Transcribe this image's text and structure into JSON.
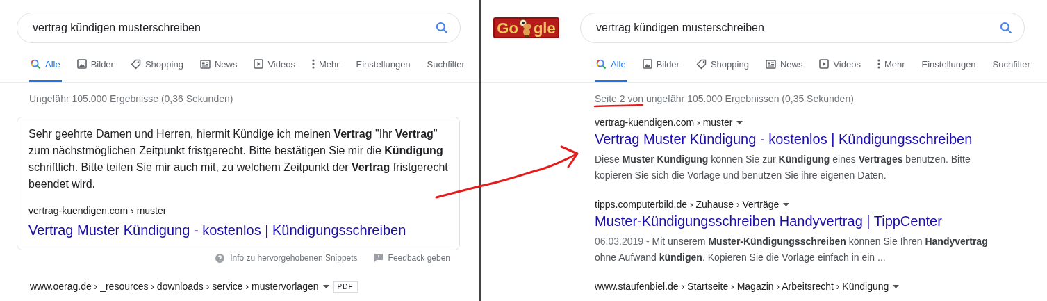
{
  "annotation": {
    "kind": "arrow-and-underline"
  },
  "panels": [
    {
      "search": {
        "value": "vertrag kündigen musterschreiben"
      },
      "tabs": [
        {
          "label": "Alle",
          "kind": "search",
          "selected": true
        },
        {
          "label": "Bilder",
          "kind": "image",
          "selected": false
        },
        {
          "label": "Shopping",
          "kind": "tag",
          "selected": false
        },
        {
          "label": "News",
          "kind": "news",
          "selected": false
        },
        {
          "label": "Videos",
          "kind": "play",
          "selected": false
        },
        {
          "label": "Mehr",
          "kind": "dots",
          "selected": false
        },
        {
          "label": "Einstellungen",
          "kind": "plain",
          "selected": false
        },
        {
          "label": "Suchfilter",
          "kind": "plain",
          "selected": false
        }
      ],
      "stats": "Ungefähr 105.000 Ergebnisse (0,36 Sekunden)",
      "featured_snippet": {
        "text": "Sehr geehrte Damen und Herren, hiermit Kündige ich meinen **Vertrag** \"Ihr **Vertrag**\" zum nächstmöglichen Zeitpunkt fristgerecht. Bitte bestätigen Sie mir die **Kündigung** schriftlich. Bitte teilen Sie mir auch mit, zu welchem Zeitpunkt der **Vertrag** fristgerecht beendet wird.",
        "url": "vertrag-kuendigen.com › muster",
        "title": "Vertrag Muster Kündigung - kostenlos | Kündigungsschreiben"
      },
      "snippet_footer": [
        {
          "label": "Info zu hervorgehobenen Snippets",
          "kind": "help"
        },
        {
          "label": "Feedback geben",
          "kind": "feedback"
        }
      ],
      "results": [
        {
          "url": "www.oerag.de › _resources › downloads › service › mustervorlagen",
          "badge": "PDF"
        }
      ]
    },
    {
      "logo": {
        "left": "Go",
        "right": "gle"
      },
      "search": {
        "value": "vertrag kündigen musterschreiben"
      },
      "tabs": [
        {
          "label": "Alle",
          "kind": "search",
          "selected": true
        },
        {
          "label": "Bilder",
          "kind": "image",
          "selected": false
        },
        {
          "label": "Shopping",
          "kind": "tag",
          "selected": false
        },
        {
          "label": "News",
          "kind": "news",
          "selected": false
        },
        {
          "label": "Videos",
          "kind": "play",
          "selected": false
        },
        {
          "label": "Mehr",
          "kind": "dots",
          "selected": false
        },
        {
          "label": "Einstellungen",
          "kind": "plain",
          "selected": false
        },
        {
          "label": "Suchfilter",
          "kind": "plain",
          "selected": false
        }
      ],
      "stats": "Seite 2 von ungefähr 105.000 Ergebnissen (0,35 Sekunden)",
      "results": [
        {
          "url": "vertrag-kuendigen.com › muster",
          "title": "Vertrag Muster Kündigung - kostenlos | Kündigungsschreiben",
          "description": "Diese **Muster Kündigung** können Sie zur **Kündigung** eines **Vertrages** benutzen. Bitte kopieren Sie sich die Vorlage und benutzen Sie ihre eigenen Daten."
        },
        {
          "url": "tipps.computerbild.de › Zuhause › Verträge",
          "title": "Muster-Kündigungsschreiben Handyvertrag | TippCenter",
          "date": "06.03.2019 - ",
          "description": "Mit unserem **Muster-Kündigungsschreiben** können Sie Ihren **Handyvertrag** ohne Aufwand **kündigen**. Kopieren Sie die Vorlage einfach in ein ..."
        },
        {
          "url": "www.staufenbiel.de › Startseite › Magazin › Arbeitsrecht › Kündigung"
        }
      ]
    }
  ]
}
